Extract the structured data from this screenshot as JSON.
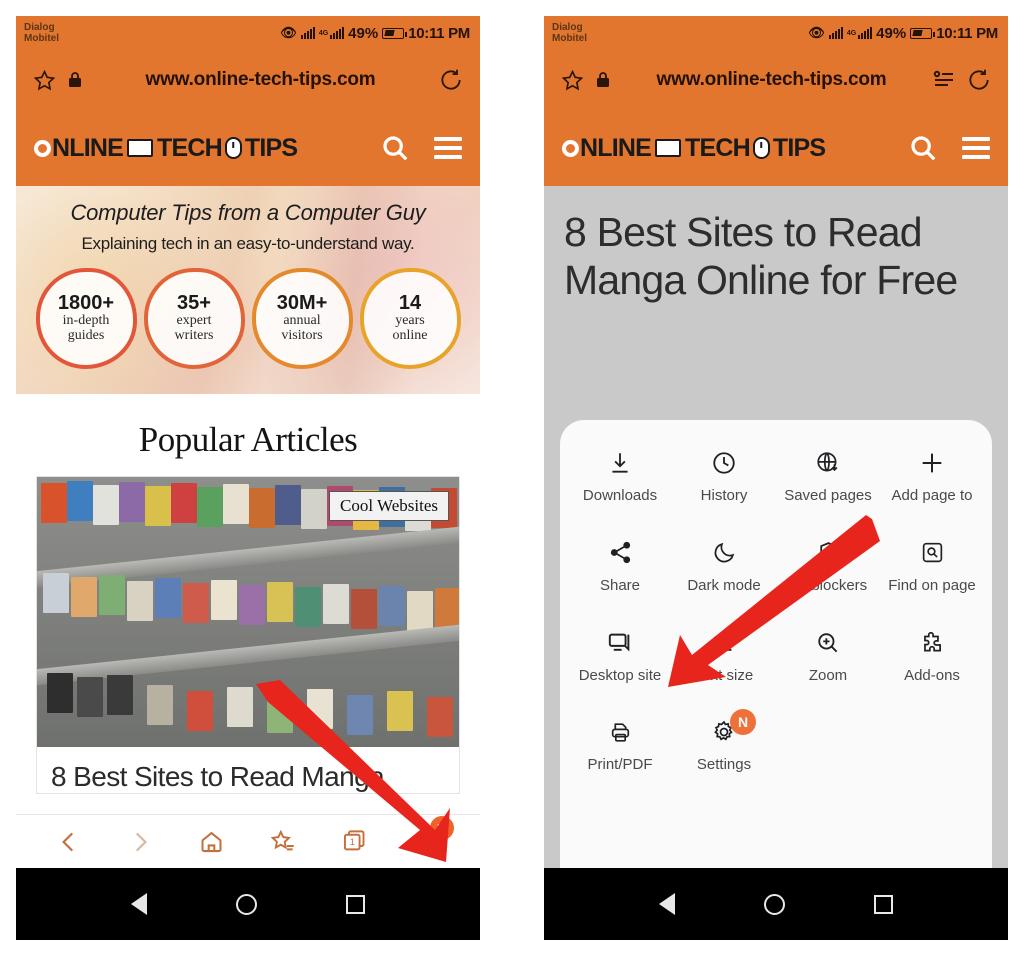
{
  "status_bar": {
    "carrier_line1": "Dialog",
    "carrier_line2": "Mobitel",
    "network": "4G",
    "battery_percent": "49%",
    "time": "10:11 PM"
  },
  "browser": {
    "url": "www.online-tech-tips.com",
    "bookmark_icon": "star-icon",
    "lock_icon": "lock-icon",
    "reader_icon": "reader-mode-icon",
    "reload_icon": "reload-icon"
  },
  "site_header": {
    "logo_part1": "NLINE",
    "logo_part2": "TECH",
    "logo_part3": "TIPS",
    "search_icon": "search-icon",
    "menu_icon": "hamburger-icon"
  },
  "hero": {
    "tagline": "Computer Tips from a Computer Guy",
    "subline": "Explaining tech in an easy-to-understand way.",
    "stats": [
      {
        "value": "1800+",
        "line1": "in-depth",
        "line2": "guides",
        "color": "#E2563A"
      },
      {
        "value": "35+",
        "line1": "expert",
        "line2": "writers",
        "color": "#E2653A"
      },
      {
        "value": "30M+",
        "line1": "annual",
        "line2": "visitors",
        "color": "#E4892C"
      },
      {
        "value": "14",
        "line1": "years",
        "line2": "online",
        "color": "#E8A32B"
      }
    ]
  },
  "popular": {
    "section_title": "Popular Articles",
    "card_category": "Cool Websites",
    "card_title": "8 Best Sites to Read Manga"
  },
  "browser_bar": {
    "items": [
      {
        "name": "back-button",
        "icon": "chevron-left-icon",
        "dim": false
      },
      {
        "name": "forward-button",
        "icon": "chevron-right-icon",
        "dim": true
      },
      {
        "name": "home-button",
        "icon": "home-icon",
        "dim": false
      },
      {
        "name": "bookmarks-button",
        "icon": "star-list-icon",
        "dim": false
      },
      {
        "name": "tabs-button",
        "icon": "tabs-icon",
        "dim": false
      },
      {
        "name": "menu-button",
        "icon": "hamburger-icon",
        "dim": false
      }
    ],
    "tab_count": "1",
    "menu_badge": "N"
  },
  "android_nav": {
    "back": "back-triangle-icon",
    "home": "home-circle-icon",
    "recents": "recents-square-icon"
  },
  "article_page": {
    "headline": "8 Best Sites to Read Manga Online for Free"
  },
  "menu_sheet": {
    "items": [
      {
        "label": "Downloads",
        "icon": "download-icon",
        "badge": ""
      },
      {
        "label": "History",
        "icon": "clock-icon",
        "badge": ""
      },
      {
        "label": "Saved pages",
        "icon": "globe-save-icon",
        "badge": ""
      },
      {
        "label": "Add page to",
        "icon": "plus-icon",
        "badge": ""
      },
      {
        "label": "Share",
        "icon": "share-icon",
        "badge": ""
      },
      {
        "label": "Dark mode",
        "icon": "moon-icon",
        "badge": ""
      },
      {
        "label": "Ad blockers",
        "icon": "shield-block-icon",
        "badge": ""
      },
      {
        "label": "Find on page",
        "icon": "find-page-icon",
        "badge": ""
      },
      {
        "label": "Desktop site",
        "icon": "desktop-icon",
        "badge": ""
      },
      {
        "label": "Text size",
        "icon": "text-size-icon",
        "badge": ""
      },
      {
        "label": "Zoom",
        "icon": "zoom-in-icon",
        "badge": ""
      },
      {
        "label": "Add-ons",
        "icon": "puzzle-icon",
        "badge": ""
      },
      {
        "label": "Print/PDF",
        "icon": "printer-icon",
        "badge": ""
      },
      {
        "label": "Settings",
        "icon": "gear-icon",
        "badge": "N"
      }
    ]
  },
  "annotations": {
    "arrow_color": "#E8251C",
    "left_arrow_target": "menu-button",
    "right_arrow_target": "Desktop site"
  },
  "colors": {
    "brand_orange": "#E2762E",
    "badge_orange": "#F0612B",
    "page_gray": "#C9C9C9",
    "sheet_white": "#FAFAFA"
  }
}
